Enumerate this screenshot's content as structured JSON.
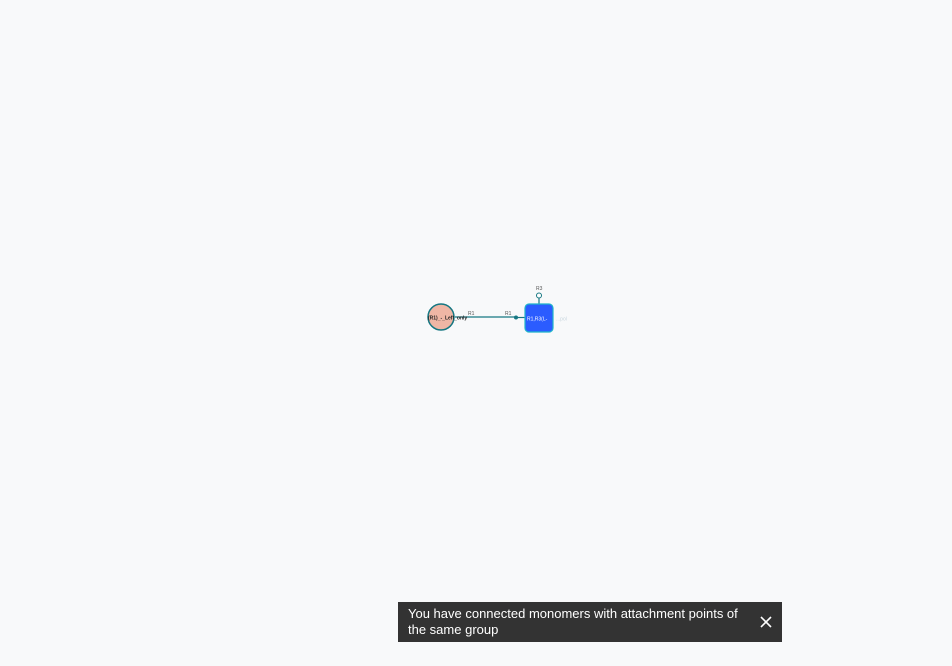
{
  "canvas": {
    "background": "#f8f9fa",
    "bond_color": "#167782",
    "monomers": [
      {
        "label": "(R1)_-_Left_only",
        "shape": "circle",
        "fill": "#efb6a5",
        "attachment_label": "R1"
      },
      {
        "label": "R1,R3(L-",
        "trailing_label": "...pol",
        "shape": "rounded-square",
        "fill": "#2b5cff",
        "attachment_labels": [
          "R1",
          "R3"
        ]
      }
    ]
  },
  "toast": {
    "message": "You have connected monomers with attachment points of the same group",
    "close_icon": "close-icon"
  }
}
